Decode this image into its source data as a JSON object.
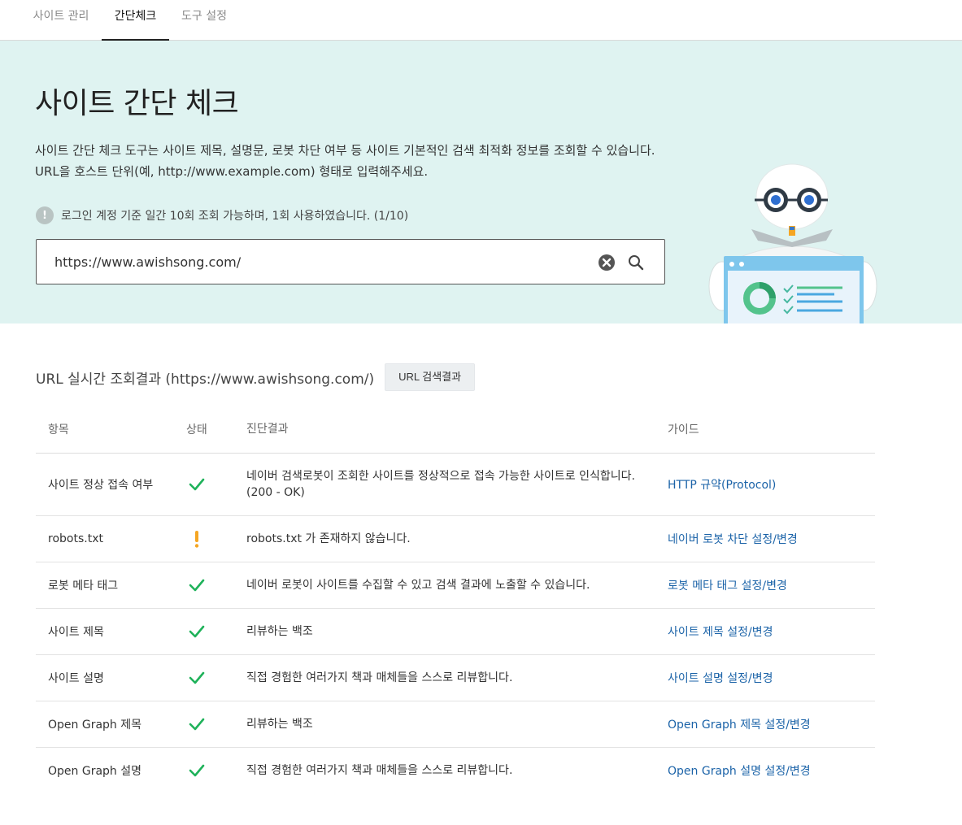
{
  "tabs": [
    {
      "label": "사이트 관리"
    },
    {
      "label": "간단체크"
    },
    {
      "label": "도구 설정"
    }
  ],
  "hero": {
    "title": "사이트 간단 체크",
    "desc_line1": "사이트 간단 체크 도구는 사이트 제목, 설명문, 로봇 차단 여부 등 사이트 기본적인 검색 최적화 정보를 조회할 수 있습니다.",
    "desc_line2": "URL을 호스트 단위(예, http://www.example.com) 형태로 입력해주세요.",
    "notice_icon": "!",
    "notice": "로그인 계정 기준 일간 10회 조회 가능하며, 1회 사용하였습니다. (1/10)",
    "search_value": "https://www.awishsong.com/"
  },
  "results": {
    "title": "URL 실시간 조회결과 (https://www.awishsong.com/)",
    "button_label": "URL 검색결과",
    "headers": {
      "item": "항목",
      "status": "상태",
      "diagnosis": "진단결과",
      "guide": "가이드"
    },
    "rows": [
      {
        "item": "사이트 정상 접속 여부",
        "status": "ok",
        "diagnosis": "네이버 검색로봇이 조회한 사이트를 정상적으로 접속 가능한 사이트로 인식합니다.",
        "diagnosis2": "(200 - OK)",
        "guide": "HTTP 규약(Protocol)"
      },
      {
        "item": "robots.txt",
        "status": "warning",
        "diagnosis": "robots.txt 가 존재하지 않습니다.",
        "guide": "네이버 로봇 차단 설정/변경"
      },
      {
        "item": "로봇 메타 태그",
        "status": "ok",
        "diagnosis": "네이버 로봇이 사이트를 수집할 수 있고 검색 결과에 노출할 수 있습니다.",
        "guide": "로봇 메타 태그 설정/변경"
      },
      {
        "item": "사이트 제목",
        "status": "ok",
        "diagnosis": "리뷰하는 백조",
        "guide": "사이트 제목 설정/변경"
      },
      {
        "item": "사이트 설명",
        "status": "ok",
        "diagnosis": "직접 경험한 여러가지 책과 매체들을 스스로 리뷰합니다.",
        "guide": "사이트 설명 설정/변경"
      },
      {
        "item": "Open Graph 제목",
        "status": "ok",
        "diagnosis": "리뷰하는 백조",
        "guide": "Open Graph 제목 설정/변경"
      },
      {
        "item": "Open Graph 설명",
        "status": "ok",
        "diagnosis": "직접 경험한 여러가지 책과 매체들을 스스로 리뷰합니다.",
        "guide": "Open Graph 설명 설정/변경"
      }
    ]
  },
  "colors": {
    "hero_bg": "#dff3f1",
    "ok": "#1fb25a",
    "warning": "#f5a623",
    "link": "#1b63a8"
  },
  "icons": {
    "ok": "check-icon",
    "warning": "exclamation-icon",
    "clear": "clear-circle-icon",
    "search": "search-icon"
  }
}
